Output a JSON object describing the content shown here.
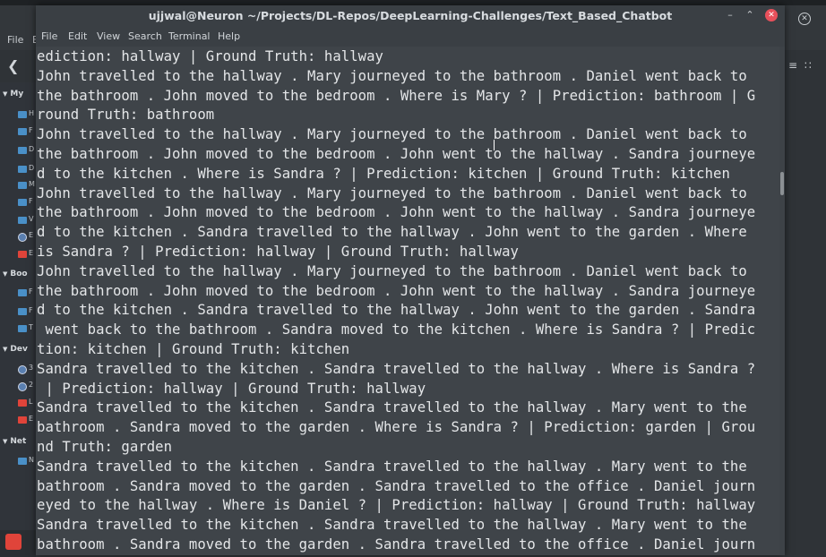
{
  "background_window": {
    "menu": [
      "File",
      "E"
    ],
    "sidebar_sections": [
      {
        "label": "My"
      },
      {
        "label": "Boo"
      },
      {
        "label": "Dev"
      },
      {
        "label": "Net"
      }
    ],
    "sidebar_items": [
      "H",
      "F",
      "D",
      "D",
      "M",
      "F",
      "V",
      "E",
      "E",
      "F",
      "F",
      "T",
      "3",
      "2",
      "L",
      "E",
      "N"
    ]
  },
  "terminal": {
    "title": "ujjwal@Neuron ~/Projects/DL-Repos/DeepLearning-Challenges/Text_Based_Chatbot",
    "controls": {
      "minimize": "–",
      "maximize": "⌃",
      "close": "✕"
    },
    "menu": [
      "File",
      "Edit",
      "View",
      "Search",
      "Terminal",
      "Help"
    ],
    "lines": [
      "ediction: hallway | Ground Truth: hallway",
      "John travelled to the hallway . Mary journeyed to the bathroom . Daniel went back to",
      "the bathroom . John moved to the bedroom . Where is Mary ? | Prediction: bathroom | G",
      "round Truth: bathroom",
      "John travelled to the hallway . Mary journeyed to the bathroom . Daniel went back to",
      "the bathroom . John moved to the bedroom . John went to the hallway . Sandra journeye",
      "d to the kitchen . Where is Sandra ? | Prediction: kitchen | Ground Truth: kitchen",
      "John travelled to the hallway . Mary journeyed to the bathroom . Daniel went back to",
      "the bathroom . John moved to the bedroom . John went to the hallway . Sandra journeye",
      "d to the kitchen . Sandra travelled to the hallway . John went to the garden . Where",
      "is Sandra ? | Prediction: hallway | Ground Truth: hallway",
      "John travelled to the hallway . Mary journeyed to the bathroom . Daniel went back to",
      "the bathroom . John moved to the bedroom . John went to the hallway . Sandra journeye",
      "d to the kitchen . Sandra travelled to the hallway . John went to the garden . Sandra",
      " went back to the bathroom . Sandra moved to the kitchen . Where is Sandra ? | Predic",
      "tion: kitchen | Ground Truth: kitchen",
      "Sandra travelled to the kitchen . Sandra travelled to the hallway . Where is Sandra ?",
      " | Prediction: hallway | Ground Truth: hallway",
      "Sandra travelled to the kitchen . Sandra travelled to the hallway . Mary went to the",
      "bathroom . Sandra moved to the garden . Where is Sandra ? | Prediction: garden | Grou",
      "nd Truth: garden",
      "Sandra travelled to the kitchen . Sandra travelled to the hallway . Mary went to the",
      "bathroom . Sandra moved to the garden . Sandra travelled to the office . Daniel journ",
      "eyed to the hallway . Where is Daniel ? | Prediction: hallway | Ground Truth: hallway",
      "Sandra travelled to the kitchen . Sandra travelled to the hallway . Mary went to the",
      "bathroom . Sandra moved to the garden . Sandra travelled to the office . Daniel journ"
    ]
  }
}
